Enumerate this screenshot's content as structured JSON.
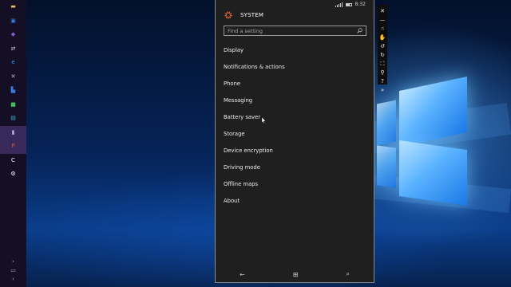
{
  "phone": {
    "status": {
      "time": "8:32"
    },
    "header": {
      "title": "SYSTEM"
    },
    "search": {
      "placeholder": "Find a setting"
    },
    "settings": [
      {
        "label": "Display"
      },
      {
        "label": "Notifications & actions"
      },
      {
        "label": "Phone"
      },
      {
        "label": "Messaging"
      },
      {
        "label": "Battery saver"
      },
      {
        "label": "Storage"
      },
      {
        "label": "Device encryption"
      },
      {
        "label": "Driving mode"
      },
      {
        "label": "Offline maps"
      },
      {
        "label": "About"
      }
    ],
    "nav": {
      "back": "←",
      "start": "⊞",
      "search": "⌕"
    },
    "accent_color": "#e8643c"
  },
  "taskbar": {
    "icons": [
      {
        "name": "file-explorer-icon",
        "glyph": "▬",
        "color": "#e6c35a"
      },
      {
        "name": "outlook-icon",
        "glyph": "▣",
        "color": "#3b7de0"
      },
      {
        "name": "visual-studio-icon",
        "glyph": "◆",
        "color": "#8b5cd6"
      },
      {
        "name": "network-icon",
        "glyph": "⇄",
        "color": "#c7c2d6"
      },
      {
        "name": "internet-explorer-icon",
        "glyph": "e",
        "color": "#2f9be8"
      },
      {
        "name": "tools-icon",
        "glyph": "✕",
        "color": "#c7c2d6"
      },
      {
        "name": "vs-code-icon",
        "glyph": "▙",
        "color": "#3b7de0"
      },
      {
        "name": "green-app-icon",
        "glyph": "■",
        "color": "#3fbf5a"
      },
      {
        "name": "monitor-icon",
        "glyph": "▤",
        "color": "#3fb3c9"
      },
      {
        "name": "phone-emulator-icon",
        "glyph": "▮",
        "color": "#b9a8e8"
      },
      {
        "name": "powerpoint-icon",
        "glyph": "P",
        "color": "#d8532c"
      },
      {
        "name": "c-app-icon",
        "glyph": "C",
        "color": "#ffffff"
      },
      {
        "name": "settings-gear-icon",
        "glyph": "⚙",
        "color": "#ffffff"
      }
    ],
    "bottom": {
      "chevron_up": "›",
      "tray": "▭",
      "chevron_down": "‹"
    }
  },
  "emulator_toolbar": {
    "tools": [
      {
        "name": "close-icon",
        "glyph": "✕"
      },
      {
        "name": "minimize-icon",
        "glyph": "—"
      },
      {
        "name": "single-touch-icon",
        "glyph": "☝"
      },
      {
        "name": "multi-touch-icon",
        "glyph": "✋"
      },
      {
        "name": "rotate-left-icon",
        "glyph": "↺"
      },
      {
        "name": "rotate-right-icon",
        "glyph": "↻"
      },
      {
        "name": "fit-to-screen-icon",
        "glyph": "⛶"
      },
      {
        "name": "zoom-icon",
        "glyph": "⚲"
      },
      {
        "name": "help-icon",
        "glyph": "?"
      },
      {
        "name": "additional-tools-icon",
        "glyph": "»"
      }
    ]
  }
}
